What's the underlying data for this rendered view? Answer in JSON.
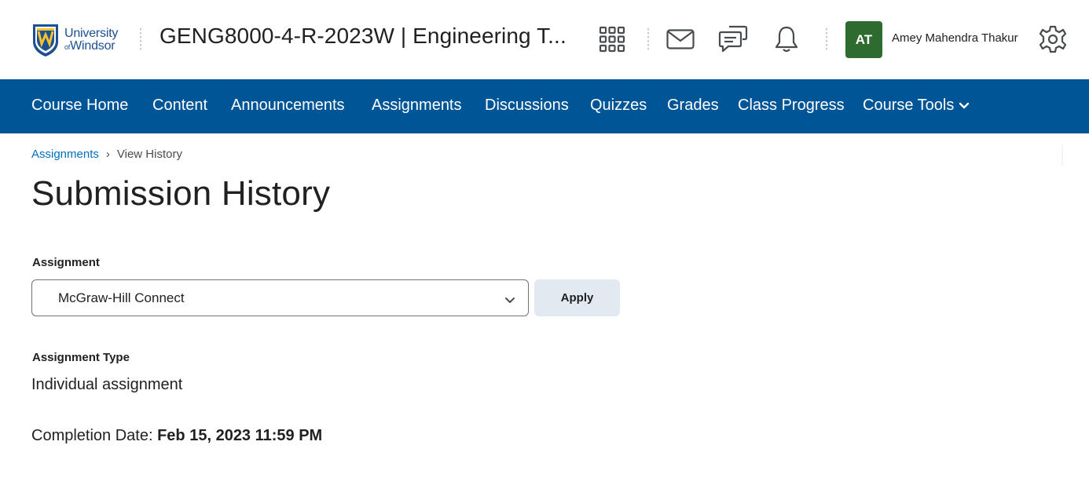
{
  "header": {
    "logo": {
      "line1": "University",
      "line2_prefix": "of",
      "line2": "Windsor",
      "icon": "university-shield-logo"
    },
    "course_title": "GENG8000-4-R-2023W | Engineering T...",
    "icons": [
      "apps-grid-icon",
      "mail-icon",
      "chat-bubbles-icon",
      "bell-icon",
      "gear-icon"
    ],
    "user": {
      "initials": "AT",
      "name": "Amey Mahendra Thakur",
      "avatar_color": "#2d6b2f"
    }
  },
  "nav": {
    "color": "#005596",
    "items": [
      {
        "label": "Course Home"
      },
      {
        "label": "Content"
      },
      {
        "label": "Announcements"
      },
      {
        "label": "Assignments"
      },
      {
        "label": "Discussions"
      },
      {
        "label": "Quizzes"
      },
      {
        "label": "Grades"
      },
      {
        "label": "Class Progress"
      },
      {
        "label": "Course Tools"
      }
    ]
  },
  "breadcrumb": {
    "link": "Assignments",
    "separator": "›",
    "current": "View History"
  },
  "page": {
    "title": "Submission History",
    "assignment_label": "Assignment",
    "assignment_selected": "McGraw-Hill Connect",
    "apply_label": "Apply",
    "type_label": "Assignment Type",
    "type_value": "Individual assignment",
    "completion_label": "Completion Date:",
    "completion_value": "Feb 15, 2023 11:59 PM"
  }
}
